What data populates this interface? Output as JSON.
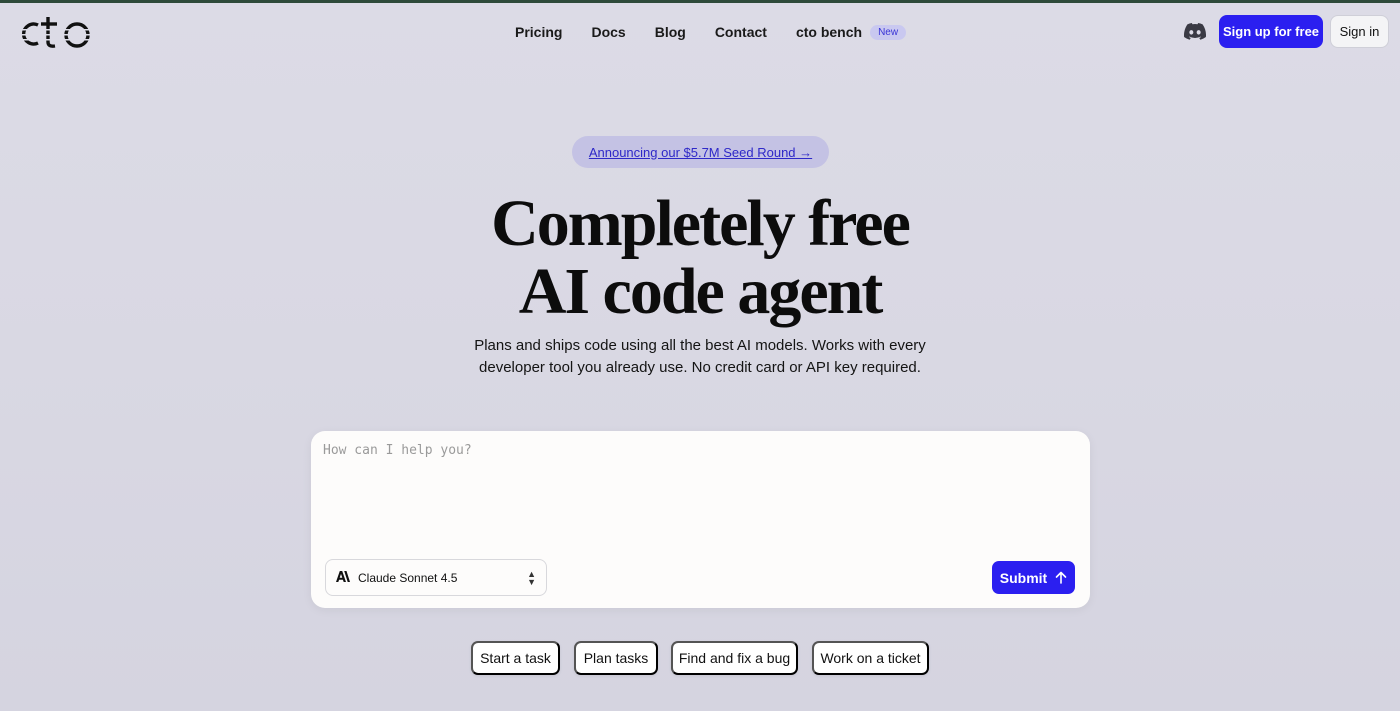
{
  "header": {
    "logo_icon": "cto-logo",
    "nav": [
      {
        "label": "Pricing"
      },
      {
        "label": "Docs"
      },
      {
        "label": "Blog"
      },
      {
        "label": "Contact"
      },
      {
        "label": "cto bench",
        "badge": "New"
      }
    ],
    "discord_icon": "discord-icon",
    "signup_label": "Sign up for free",
    "signin_label": "Sign in"
  },
  "hero": {
    "announcement": "Announcing our $5.7M Seed Round →",
    "headline_line1": "Completely free",
    "headline_line2": "AI code agent",
    "sub_line1": "Plans and ships code using all the best AI models. Works with every",
    "sub_line2": "developer tool you already use. No credit card or API key required."
  },
  "prompt": {
    "placeholder": "How can I help you?",
    "value": "",
    "model": "Claude Sonnet 4.5",
    "model_icon": "anthropic-icon",
    "submit_label": "Submit"
  },
  "chips": [
    {
      "label": "Start a task"
    },
    {
      "label": "Plan tasks"
    },
    {
      "label": "Find and fix a bug"
    },
    {
      "label": "Work on a ticket"
    }
  ],
  "colors": {
    "accent": "#2b1ff0",
    "background": "#dcdbe6",
    "announce_bg": "#c4c2e4"
  }
}
